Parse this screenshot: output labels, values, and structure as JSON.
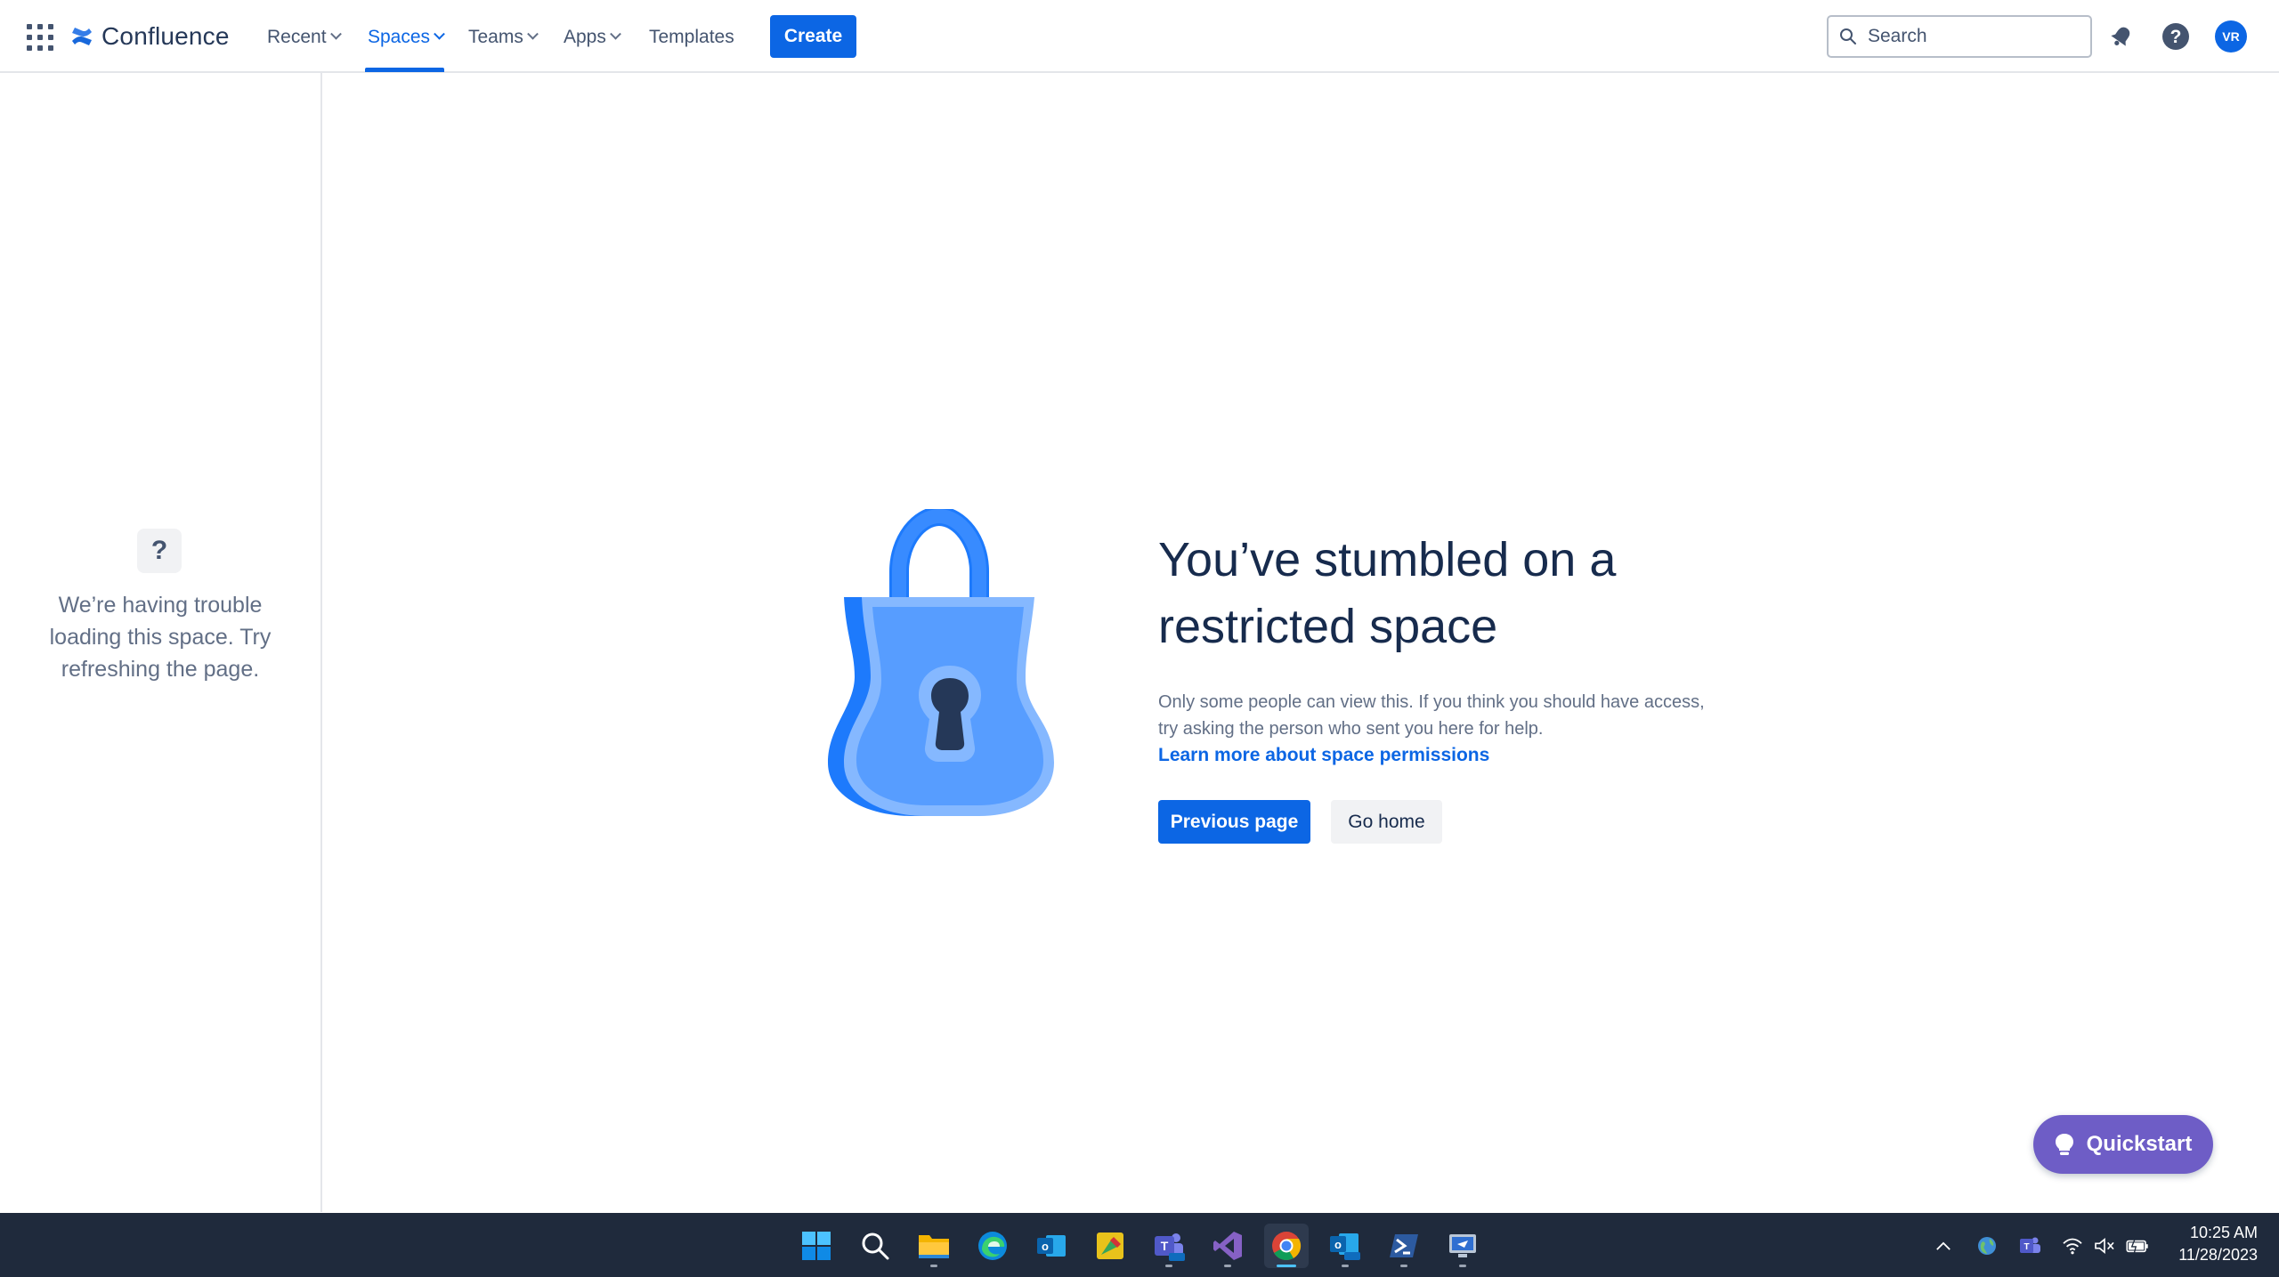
{
  "header": {
    "logo_text": "Confluence",
    "nav": [
      {
        "label": "Recent",
        "has_dropdown": true
      },
      {
        "label": "Spaces",
        "has_dropdown": true,
        "active": true
      },
      {
        "label": "Teams",
        "has_dropdown": true
      },
      {
        "label": "Apps",
        "has_dropdown": true
      },
      {
        "label": "Templates",
        "has_dropdown": false
      }
    ],
    "create_label": "Create",
    "search_placeholder": "Search",
    "avatar_initials": "VR",
    "icons": [
      "app-switcher-icon",
      "confluence-logo-icon",
      "search-icon",
      "notifications-icon",
      "help-icon"
    ]
  },
  "sidebar": {
    "icon": "question-mark-icon",
    "icon_glyph": "?",
    "message": "We’re having trouble loading this space. Try refreshing the page."
  },
  "main": {
    "illustration": "padlock-icon",
    "headline": "You’ve stumbled on a restricted space",
    "description": "Only some people can view this. If you think you should have access, try asking the person who sent you here for help.",
    "learn_more_link": "Learn more about space permissions",
    "primary_button": "Previous page",
    "secondary_button": "Go home"
  },
  "quickstart": {
    "label": "Quickstart",
    "icon": "lightbulb-icon"
  },
  "taskbar": {
    "apps": [
      "windows-start-icon",
      "search-icon",
      "file-explorer-icon",
      "edge-icon",
      "outlook-icon",
      "sticky-app-icon",
      "teams-new-icon",
      "visual-studio-icon",
      "chrome-icon",
      "outlook-new-icon",
      "powershell-icon",
      "remote-desktop-icon"
    ],
    "active_app": "chrome-icon",
    "tray_icons": [
      "chevron-up-icon",
      "globe-icon",
      "teams-tray-icon",
      "wifi-icon",
      "speaker-muted-icon",
      "battery-icon"
    ],
    "time": "10:25 AM",
    "date": "11/28/2023"
  },
  "colors": {
    "brand_blue": "#0c66e4",
    "quickstart_purple": "#6e5dc6",
    "taskbar_bg": "#1f2a3c",
    "lock_light": "#85b8ff",
    "lock_mid": "#579dff",
    "lock_dark": "#1d7afc"
  }
}
